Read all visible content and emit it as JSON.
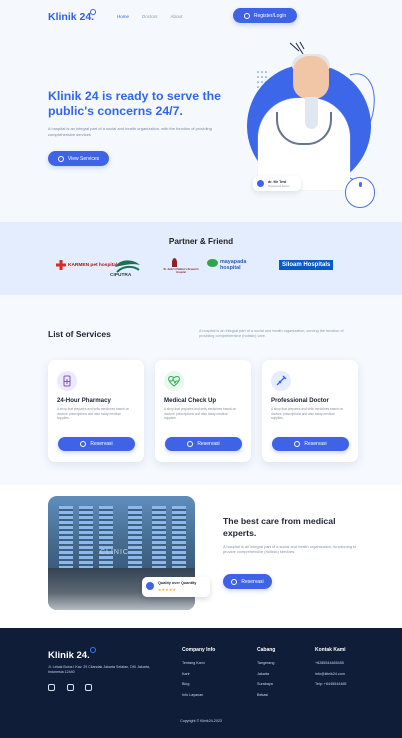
{
  "header": {
    "brand": "Klinik 24.",
    "nav": [
      "Home",
      "Doctors",
      "About"
    ],
    "login": "Register/Login",
    "title": "Klinik 24 is ready to serve the public's concerns 24/7.",
    "description": "A hospital is an integral part of a social and health organization, with the function of providing comprehensive services",
    "services_button": "View Services",
    "doctor_name": "dr. Mr Test",
    "doctor_role": "Registered Doctor"
  },
  "partners": {
    "title": "Partner & Friend",
    "logos": [
      "KARMEN pet hospital",
      "CIPUTRA",
      "St. Jude's Children's Research Hospital",
      "mayapada hospital",
      "Siloam Hospitals"
    ]
  },
  "services": {
    "title": "List of Services",
    "description": "A hospital is an integral part of a social and health organization, serving the function of providing comprehensive (holistic) care.",
    "cards": [
      {
        "title": "24-Hour Pharmacy",
        "description": "A shop that prepares and sells medicines based on doctors' prescriptions and also today medical supplies.",
        "button": "Reservasi"
      },
      {
        "title": "Medical Check Up",
        "description": "A shop that prepares and sells medicines based on doctors' prescriptions and also today medical supplies.",
        "button": "Reservasi"
      },
      {
        "title": "Professional Doctor",
        "description": "A shop that prepares and sells medicines based on doctors' prescriptions and also today medical supplies.",
        "button": "Reservasi"
      }
    ]
  },
  "best": {
    "quality": "Quality over Quantity",
    "stars": "★★★★★",
    "title": "The best care from medical experts.",
    "description": "A hospital is an integral part of a social and health organization, functioning to provide comprehensive (holistic) services.",
    "button": "Reservasi",
    "building_sign": "CLINIC"
  },
  "footer": {
    "brand": "Klinik 24.",
    "address": "Jl. Lebak Bulus I Kav. 29 Cilandak Jakarta Selatan, DKI Jakarta, Indonesia 12440",
    "company_title": "Company Info",
    "company_links": [
      "Tentang Kami",
      "Karir",
      "Blog",
      "Info Layanan"
    ],
    "branch_title": "Cabang",
    "branches": [
      "Tangerang",
      "Jakarta",
      "Surabaya",
      "Bekasi"
    ],
    "contact_title": "Kontak Kami",
    "contacts": [
      "+6285544465455",
      "info@klinik24.com",
      "Telp: +6445544465"
    ],
    "copyright": "Copyright © Klinik24-2023"
  },
  "colors": {
    "primary": "#3f63e7",
    "footer": "#0f1d38"
  }
}
